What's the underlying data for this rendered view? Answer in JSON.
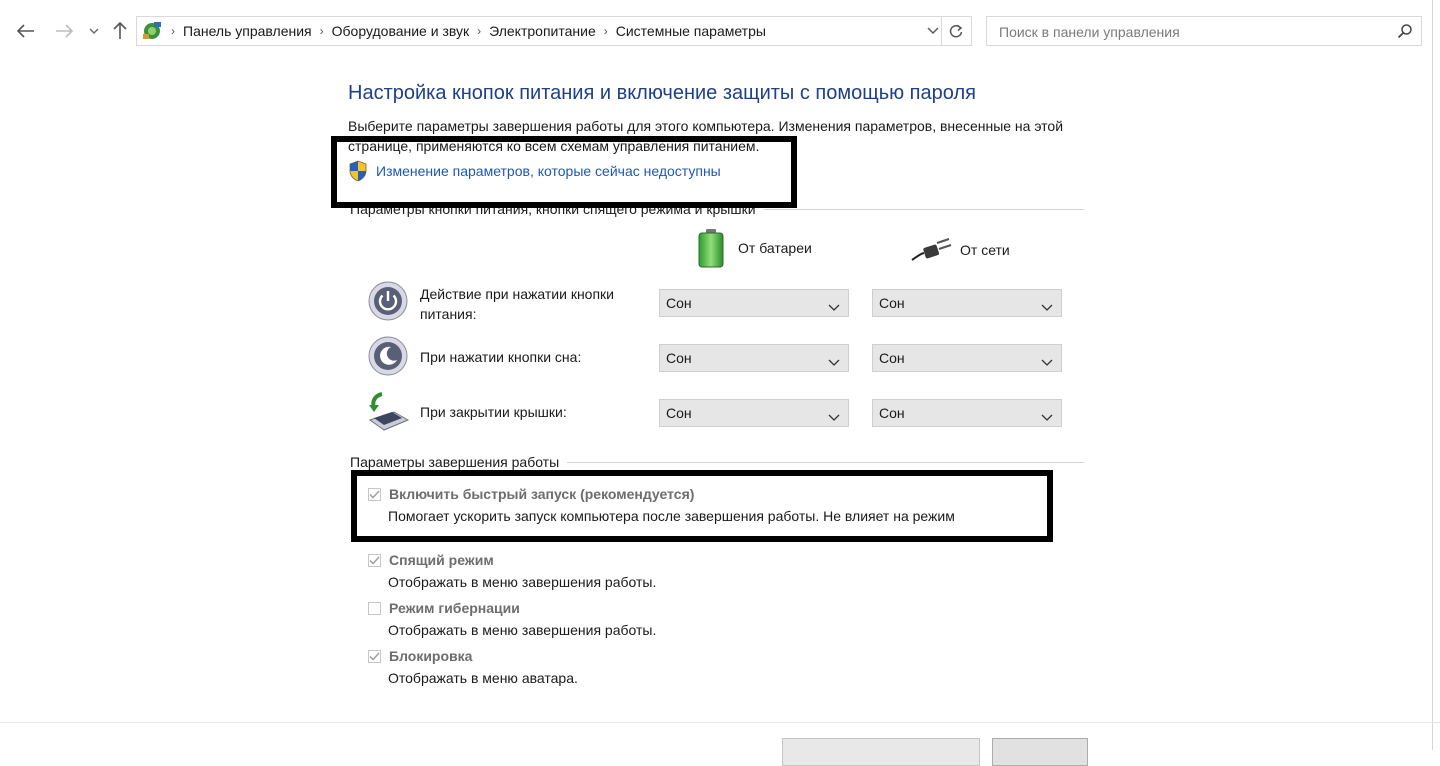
{
  "nav": {
    "breadcrumbs": [
      "Панель управления",
      "Оборудование и звук",
      "Электропитание",
      "Системные параметры"
    ],
    "search_placeholder": "Поиск в панели управления"
  },
  "page": {
    "title": "Настройка кнопок питания и включение защиты с помощью пароля",
    "description": "Выберите параметры завершения работы для этого компьютера. Изменения параметров, внесенные на этой странице, применяются ко всем схемам управления питанием.",
    "admin_link": "Изменение параметров, которые сейчас недоступны"
  },
  "power_buttons": {
    "heading": "Параметры кнопки питания, кнопки спящего режима и крышки",
    "col_battery": "От батареи",
    "col_ac": "От сети",
    "rows": [
      {
        "label": "Действие при нажатии кнопки питания:",
        "icon": "power-button-icon",
        "battery": "Сон",
        "ac": "Сон"
      },
      {
        "label": "При нажатии кнопки сна:",
        "icon": "sleep-button-icon",
        "battery": "Сон",
        "ac": "Сон"
      },
      {
        "label": "При закрытии крышки:",
        "icon": "laptop-lid-icon",
        "battery": "Сон",
        "ac": "Сон"
      }
    ]
  },
  "shutdown": {
    "heading": "Параметры завершения работы",
    "options": [
      {
        "label": "Включить быстрый запуск (рекомендуется)",
        "description": "Помогает ускорить запуск компьютера после завершения работы. Не влияет на режим",
        "checked": true
      },
      {
        "label": "Спящий режим",
        "description": "Отображать в меню завершения работы.",
        "checked": true
      },
      {
        "label": "Режим гибернации",
        "description": "Отображать в меню завершения работы.",
        "checked": false
      },
      {
        "label": "Блокировка",
        "description": "Отображать в меню аватара.",
        "checked": true
      }
    ]
  },
  "colors": {
    "title": "#1e3f8a",
    "link": "#1e57b5",
    "highlight_box": "#000000"
  }
}
